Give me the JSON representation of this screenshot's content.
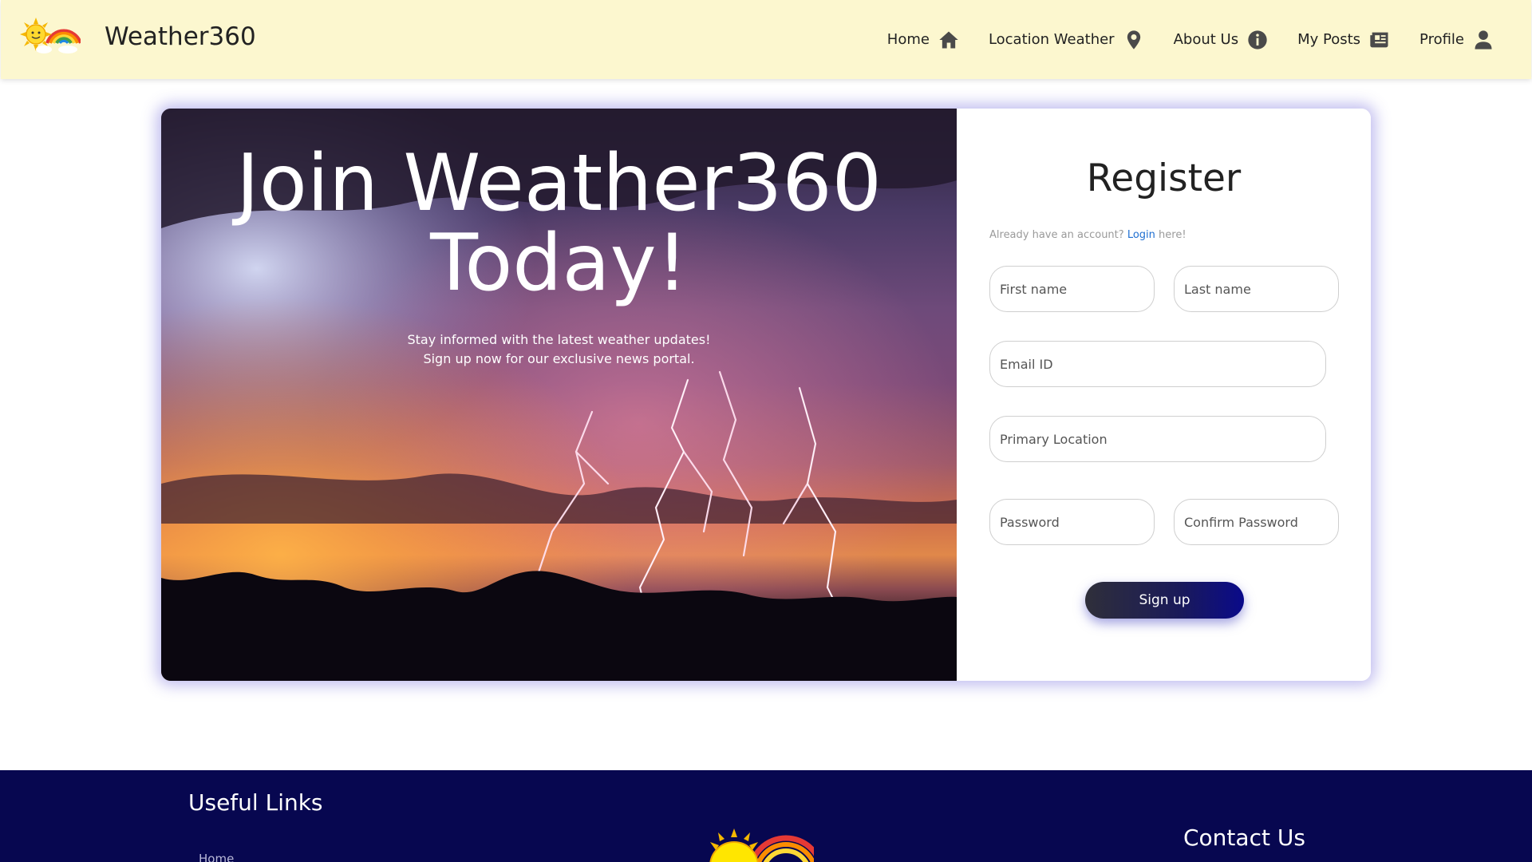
{
  "brand": {
    "name": "Weather360",
    "logo_icon": "sun-rainbow-icon"
  },
  "nav": {
    "items": [
      {
        "label": "Home",
        "icon": "home-icon"
      },
      {
        "label": "Location Weather",
        "icon": "map-pin-icon"
      },
      {
        "label": "About Us",
        "icon": "info-icon"
      },
      {
        "label": "My Posts",
        "icon": "newspaper-icon"
      },
      {
        "label": "Profile",
        "icon": "user-icon"
      }
    ]
  },
  "hero": {
    "title_line1": "Join Weather360",
    "title_line2": "Today!",
    "subtitle_line1": "Stay informed with the latest weather updates!",
    "subtitle_line2": "Sign up now for our exclusive news portal."
  },
  "register": {
    "title": "Register",
    "hint_prefix": "Already have an account?",
    "hint_link": "Login",
    "hint_suffix": "here!",
    "fields": {
      "first_name": {
        "placeholder": "First name",
        "value": ""
      },
      "last_name": {
        "placeholder": "Last name",
        "value": ""
      },
      "email": {
        "placeholder": "Email ID",
        "value": ""
      },
      "location": {
        "placeholder": "Primary Location",
        "value": ""
      },
      "password": {
        "placeholder": "Password",
        "value": ""
      },
      "confirm_password": {
        "placeholder": "Confirm Password",
        "value": ""
      }
    },
    "submit_label": "Sign up"
  },
  "footer": {
    "useful_links_title": "Useful Links",
    "links": [
      "Home"
    ],
    "contact_title": "Contact Us"
  },
  "colors": {
    "navbar_bg": "#fcf7cf",
    "footer_bg": "#070750",
    "link": "#1f6fd1",
    "button_gradient_end": "#0a0a8a"
  }
}
